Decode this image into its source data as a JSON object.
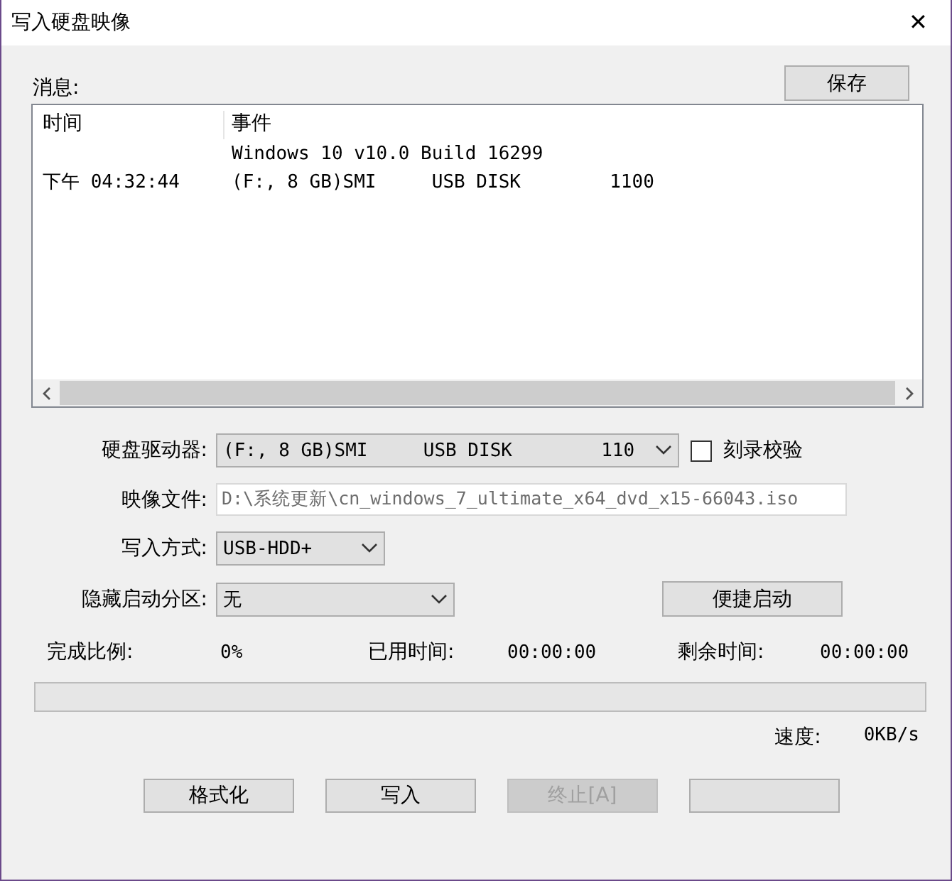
{
  "window": {
    "title": "写入硬盘映像",
    "close": "✕"
  },
  "messages": {
    "label": "消息:",
    "save_button": "保存",
    "columns": [
      "时间",
      "事件"
    ],
    "rows": [
      {
        "event": "Windows 10 v10.0 Build 16299"
      },
      {
        "time": "下午 04:32:44",
        "event": "(F:, 8 GB)SMI     USB DISK        1100"
      }
    ]
  },
  "form": {
    "drive": {
      "label": "硬盘驱动器:",
      "value": "(F:, 8 GB)SMI     USB DISK        110"
    },
    "verify": {
      "label": "刻录校验",
      "checked": false
    },
    "image_file": {
      "label": "映像文件:",
      "value": "D:\\系统更新\\cn_windows_7_ultimate_x64_dvd_x15-66043.iso"
    },
    "write_method": {
      "label": "写入方式:",
      "value": "USB-HDD+"
    },
    "hidden_partition": {
      "label": "隐藏启动分区:",
      "value": "无"
    },
    "quick_boot_button": "便捷启动"
  },
  "stats": [
    {
      "label": "完成比例:",
      "value": "0%"
    },
    {
      "label": "已用时间:",
      "value": "00:00:00"
    },
    {
      "label": "剩余时间:",
      "value": "00:00:00"
    }
  ],
  "progress": {
    "level": 0
  },
  "speed": {
    "label": "速度:",
    "value": "0KB/s"
  },
  "buttons": [
    {
      "label": "格式化",
      "disabled": false
    },
    {
      "label": "写入",
      "disabled": false
    },
    {
      "label": "终止[A]",
      "disabled": true
    },
    {
      "disabled": false
    }
  ]
}
